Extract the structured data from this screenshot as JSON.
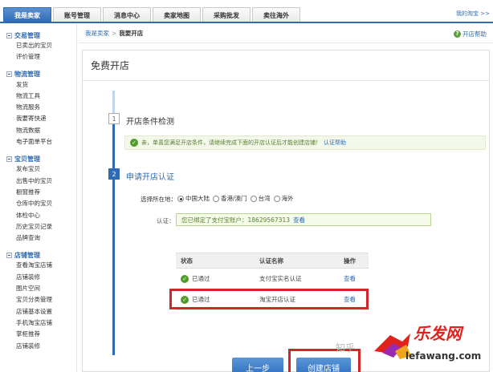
{
  "topnav": {
    "tabs": [
      "我是卖家",
      "账号管理",
      "消息中心",
      "卖家地图",
      "采购批发",
      "卖往海外"
    ],
    "shop_link": "我的淘宝 >>"
  },
  "sidebar": {
    "groups": [
      {
        "title": "交易管理",
        "items": [
          "已卖出的宝贝",
          "评价管理"
        ]
      },
      {
        "title": "物流管理",
        "items": [
          "发货",
          "物流工具",
          "物流服务",
          "我要寄快递",
          "物流数据",
          "电子面单平台"
        ]
      },
      {
        "title": "宝贝管理",
        "items": [
          "发布宝贝",
          "出售中的宝贝",
          "橱窗推荐",
          "仓库中的宝贝",
          "体检中心",
          "历史宝贝记录",
          "品牌查询"
        ]
      },
      {
        "title": "店铺管理",
        "items": [
          "查看淘宝店铺",
          "店铺装修",
          "图片空间",
          "宝贝分类管理",
          "店铺基本设置",
          "手机淘宝店铺",
          "掌柜推荐",
          "店铺装修"
        ]
      }
    ]
  },
  "breadcrumb": {
    "root": "我是卖家",
    "sep": ">",
    "current": "我要开店"
  },
  "help": {
    "icon": "?",
    "label": "开店帮助"
  },
  "panel": {
    "title": "免费开店"
  },
  "steps": [
    {
      "num": "1",
      "title": "开店条件检测"
    },
    {
      "num": "2",
      "title": "申请开店认证"
    }
  ],
  "notice": {
    "text": "亲，单喜您满足开店条件，请继续完成下面的开店认证后才能创建店铺！",
    "link": "认证帮助"
  },
  "region": {
    "label": "选择所在地：",
    "options": [
      "中国大陆",
      "香港/澳门",
      "台湾",
      "海外"
    ],
    "selected": "中国大陆"
  },
  "auth": {
    "label": "认证：",
    "text": "您已绑定了支付宝账户：18629567313",
    "link": "查看"
  },
  "table": {
    "headers": [
      "状态",
      "认证名称",
      "操作"
    ],
    "rows": [
      {
        "status": "已通过",
        "name": "支付宝实名认证",
        "action": "查看"
      },
      {
        "status": "已通过",
        "name": "淘宝开店认证",
        "action": "查看"
      }
    ]
  },
  "buttons": {
    "prev": "上一步",
    "create": "创建店铺"
  },
  "watermark": {
    "zhi": "知乎",
    "brand": "乐发网",
    "site": "lefawang.com"
  },
  "colors": {
    "accent": "#2f6bb5",
    "highlight": "#d3262b",
    "success": "#4f9b2c"
  }
}
